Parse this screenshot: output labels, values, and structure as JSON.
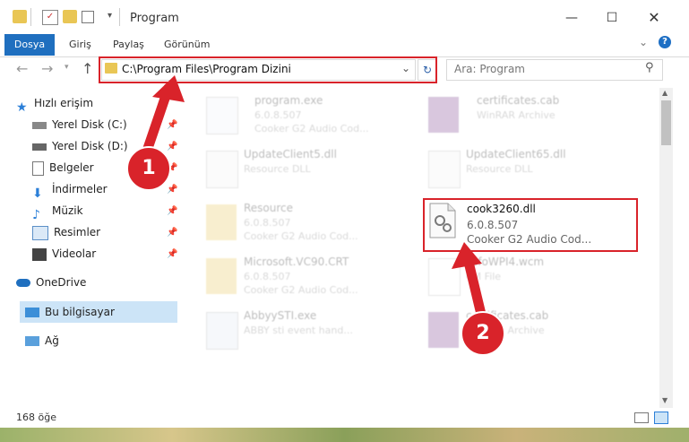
{
  "window": {
    "title": "Program"
  },
  "ribbon": {
    "tabs": [
      "Dosya",
      "Giriş",
      "Paylaş",
      "Görünüm"
    ]
  },
  "address": {
    "path": "C:\\Program Files\\Program Dizini"
  },
  "search": {
    "placeholder": "Ara: Program"
  },
  "sidebar": {
    "items": [
      {
        "label": "Hızlı erişim",
        "icon": "star-icon"
      },
      {
        "label": "Yerel Disk (C:)",
        "icon": "drive-icon",
        "pinned": true
      },
      {
        "label": "Yerel Disk (D:)",
        "icon": "drive-icon",
        "pinned": true
      },
      {
        "label": "Belgeler",
        "icon": "documents-icon",
        "pinned": true
      },
      {
        "label": "İndirmeler",
        "icon": "download-icon",
        "pinned": true
      },
      {
        "label": "Müzik",
        "icon": "music-icon",
        "pinned": true
      },
      {
        "label": "Resimler",
        "icon": "pictures-icon",
        "pinned": true
      },
      {
        "label": "Videolar",
        "icon": "video-icon",
        "pinned": true
      },
      {
        "label": "OneDrive",
        "icon": "cloud-icon"
      },
      {
        "label": "Bu bilgisayar",
        "icon": "computer-icon",
        "selected": true
      },
      {
        "label": "Ağ",
        "icon": "network-icon"
      }
    ]
  },
  "files": [
    {
      "name": "program.exe",
      "line2": "6.0.8.507",
      "line3": "Cooker G2 Audio Cod..."
    },
    {
      "name": "certificates.cab",
      "line2": "WinRAR Archive",
      "line3": ""
    },
    {
      "name": "UpdateClient5.dll",
      "line2": "Resource DLL",
      "line3": ""
    },
    {
      "name": "UpdateClient65.dll",
      "line2": "Resource DLL",
      "line3": ""
    },
    {
      "name": "Resource",
      "line2": "6.0.8.507",
      "line3": "Cooker G2 Audio Cod..."
    },
    {
      "name": "cook3260.dll",
      "line2": "6.0.8.507",
      "line3": "Cooker G2 Audio Cod..."
    },
    {
      "name": "Microsoft.VC90.CRT",
      "line2": "6.0.8.507",
      "line3": "Cooker G2 Audio Cod..."
    },
    {
      "name": "vsfoWPI4.wcm",
      "line2": "CM File",
      "line3": ""
    },
    {
      "name": "AbbyySTI.exe",
      "line2": "ABBY sti event hand...",
      "line3": ""
    },
    {
      "name": "certificates.cab",
      "line2": "WinRAR Archive",
      "line3": ""
    }
  ],
  "status": {
    "count": "168 öğe"
  },
  "callouts": [
    "1",
    "2"
  ],
  "colors": {
    "accent": "#1f6fbf",
    "highlight": "#d9232a",
    "selection": "#cce4f7"
  }
}
